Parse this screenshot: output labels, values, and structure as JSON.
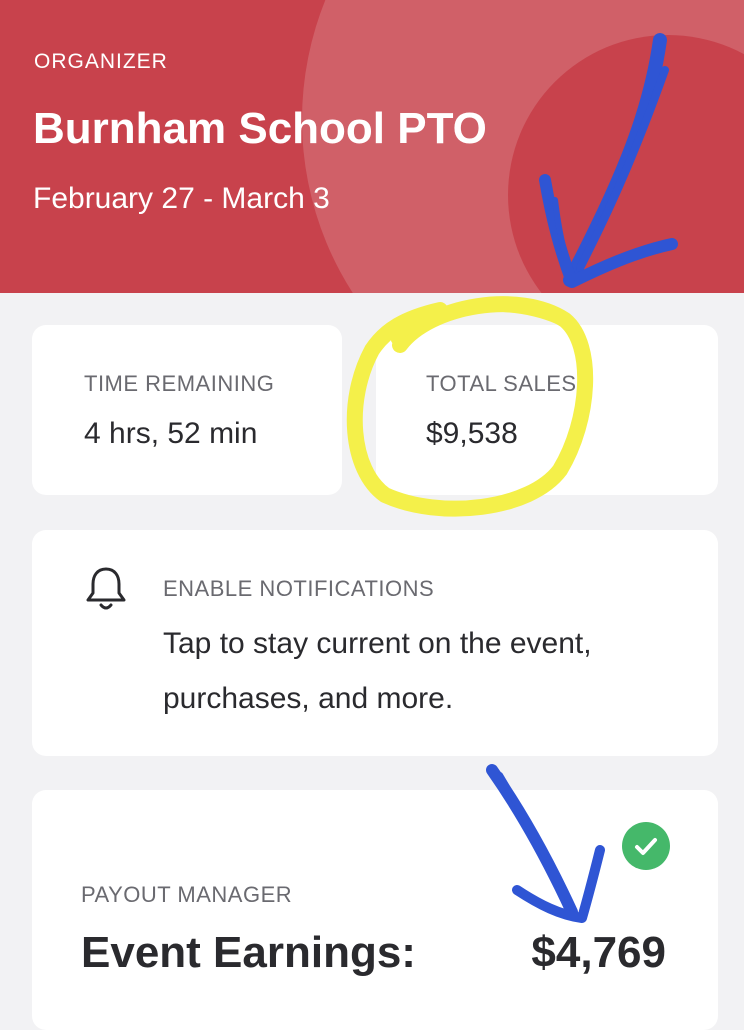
{
  "header": {
    "eyebrow": "ORGANIZER",
    "title": "Burnham School PTO",
    "dates": "February 27 - March 3"
  },
  "stats": {
    "time_remaining": {
      "label": "TIME REMAINING",
      "value": "4 hrs, 52 min"
    },
    "total_sales": {
      "label": "TOTAL SALES",
      "value": "$9,538"
    }
  },
  "notifications": {
    "icon": "bell-icon",
    "label": "ENABLE NOTIFICATIONS",
    "text": "Tap to stay current on the event, purchases, and more."
  },
  "payout": {
    "status_icon": "check-circle-icon",
    "label": "PAYOUT MANAGER",
    "earnings_label": "Event Earnings:",
    "earnings_value": "$4,769"
  },
  "colors": {
    "header_bg": "#c8424c",
    "success": "#45b86a",
    "annotation_blue": "#2f55d4",
    "annotation_yellow": "#f4f04a"
  }
}
